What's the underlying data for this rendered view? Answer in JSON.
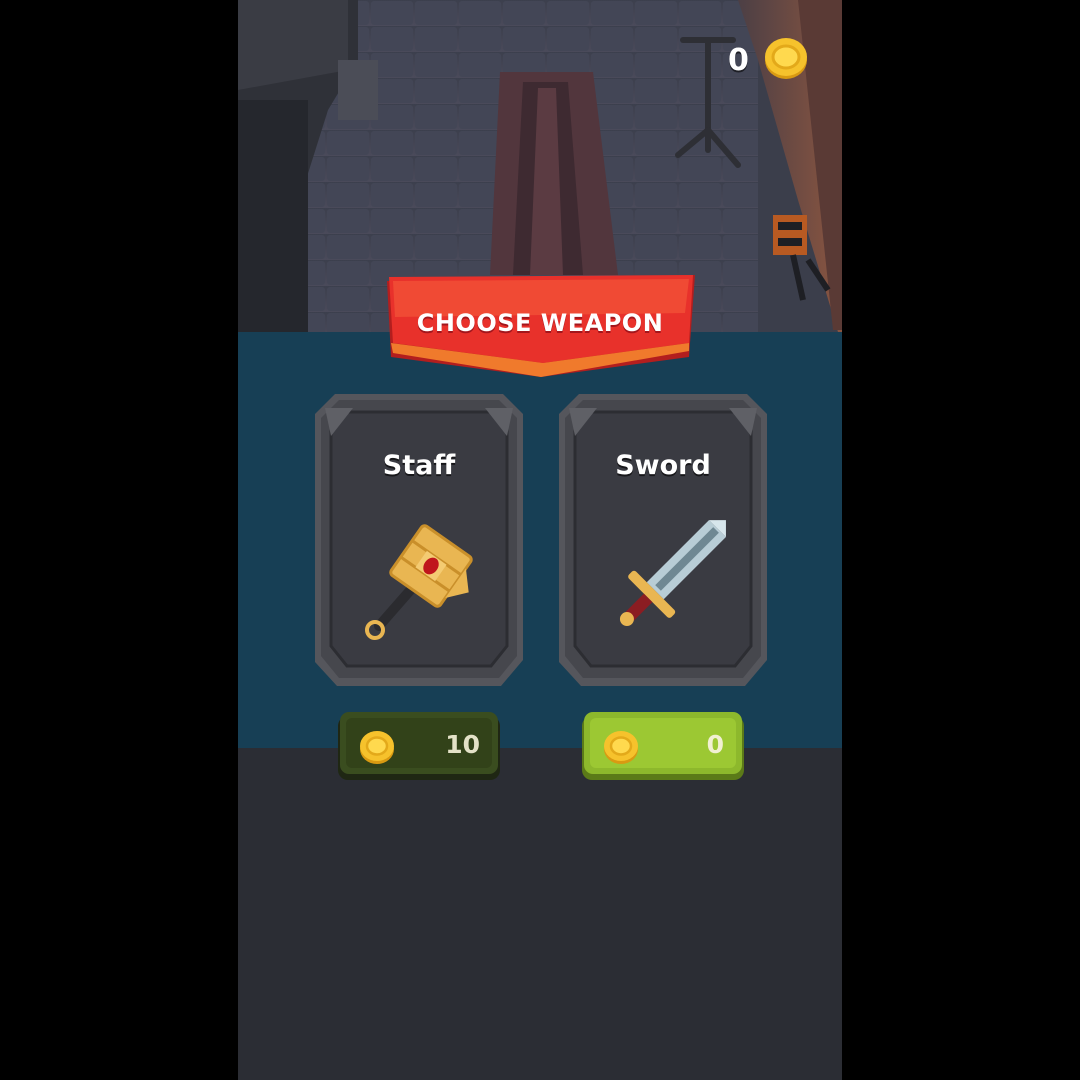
{
  "hud": {
    "coins": "0",
    "coin_icon": "gold-coin-icon"
  },
  "banner": {
    "title": "CHOOSE WEAPON",
    "color": "#e8312b"
  },
  "weapons": [
    {
      "name": "Staff",
      "icon": "staff-hammer-icon",
      "price": "10",
      "state": "locked",
      "button_color": "#3a4d1f"
    },
    {
      "name": "Sword",
      "icon": "sword-icon",
      "price": "0",
      "state": "available",
      "button_color": "#8db82c"
    }
  ],
  "colors": {
    "panel": "#173f55",
    "card": "#3a3b42",
    "coin": "#f6c22c"
  }
}
